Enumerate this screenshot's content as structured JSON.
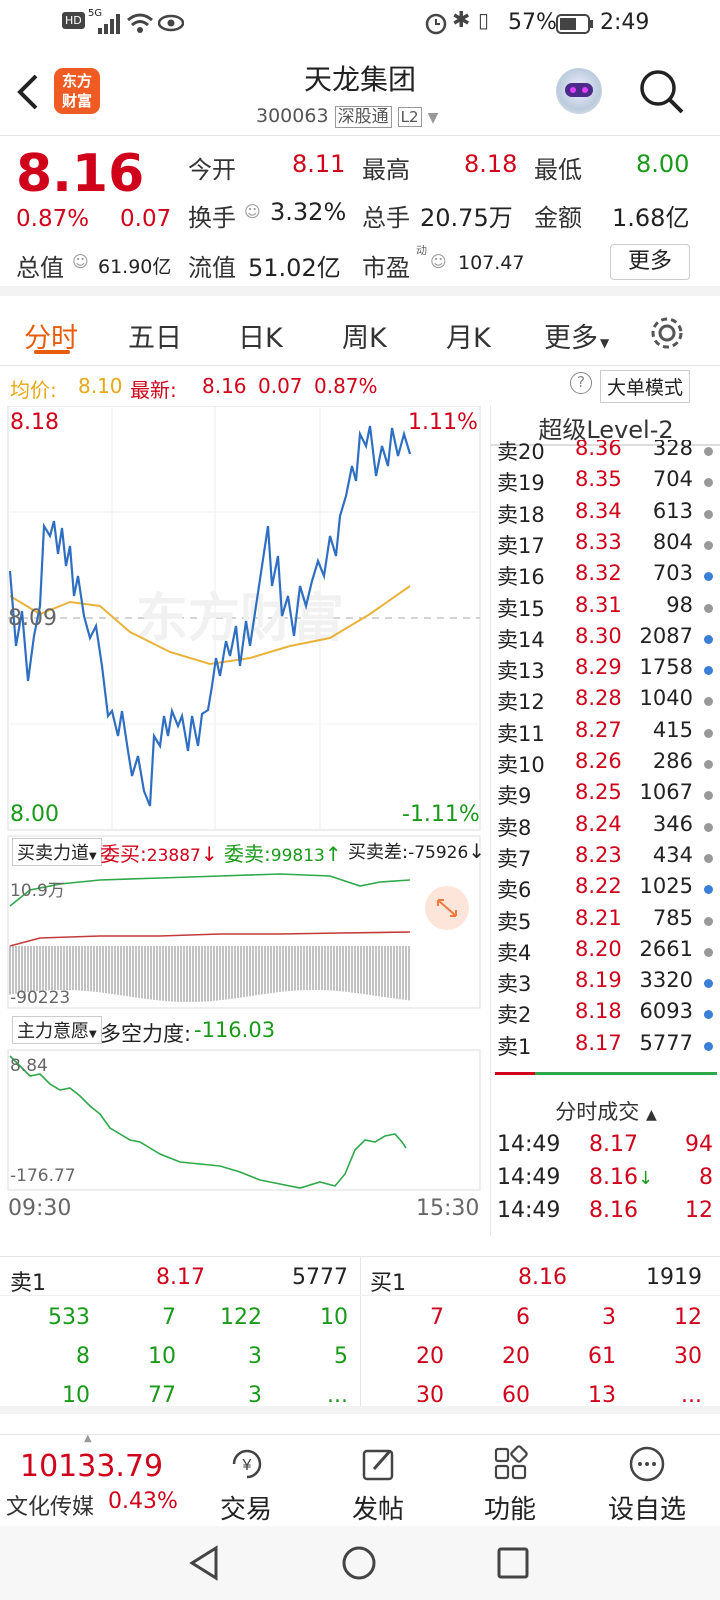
{
  "status": {
    "network": "5G",
    "battery": "57%",
    "time": "2:49"
  },
  "header": {
    "title": "天龙集团",
    "code": "300063",
    "tag1": "深股通",
    "tag2": "L2",
    "logo_line1": "东方",
    "logo_line2": "财富"
  },
  "quote": {
    "price": "8.16",
    "pct": "0.87%",
    "chg": "0.07",
    "open_label": "今开",
    "open": "8.11",
    "high_label": "最高",
    "high": "8.18",
    "low_label": "最低",
    "low": "8.00",
    "turnover_label": "换手",
    "turnover": "3.32%",
    "volume_label": "总手",
    "volume": "20.75万",
    "amount_label": "金额",
    "amount": "1.68亿",
    "mcap_label": "总值",
    "mcap": "61.90亿",
    "float_label": "流值",
    "float": "51.02亿",
    "pe_label": "市盈",
    "pe_sup": "动",
    "pe": "107.47",
    "more": "更多"
  },
  "tabs": [
    "分时",
    "五日",
    "日K",
    "周K",
    "月K",
    "更多"
  ],
  "avg": {
    "avg_label": "均价:",
    "avg": "8.10",
    "last_label": "最新:",
    "last": "8.16",
    "chg": "0.07",
    "pct": "0.87%",
    "mode": "大单模式"
  },
  "chart": {
    "ymax": "8.18",
    "ymid": "8.09",
    "ymin": "8.00",
    "pmax": "1.11%",
    "pmin": "-1.11%",
    "watermark": "东方财富",
    "t_start": "09:30",
    "t_end": "15:30"
  },
  "power": {
    "label": "买卖力道",
    "buy_label": "委买:",
    "buy": "23887",
    "sell_label": "委卖:",
    "sell": "99813",
    "diff_label": "买卖差:",
    "diff": "-75926",
    "top": "10.9万",
    "bottom": "-90223"
  },
  "intent": {
    "label": "主力意愿",
    "ls_label": "多空力度:",
    "ls": "-116.03",
    "top": "8.84",
    "bottom": "-176.77"
  },
  "level2": {
    "title": "超级Level-2",
    "rows": [
      {
        "l": "卖20",
        "p": "8.36",
        "v": "328",
        "dot": "#999"
      },
      {
        "l": "卖19",
        "p": "8.35",
        "v": "704",
        "dot": "#999"
      },
      {
        "l": "卖18",
        "p": "8.34",
        "v": "613",
        "dot": "#999"
      },
      {
        "l": "卖17",
        "p": "8.33",
        "v": "804",
        "dot": "#999"
      },
      {
        "l": "卖16",
        "p": "8.32",
        "v": "703",
        "dot": "#3b7fd6"
      },
      {
        "l": "卖15",
        "p": "8.31",
        "v": "98",
        "dot": "#999"
      },
      {
        "l": "卖14",
        "p": "8.30",
        "v": "2087",
        "dot": "#3b7fd6"
      },
      {
        "l": "卖13",
        "p": "8.29",
        "v": "1758",
        "dot": "#3b7fd6"
      },
      {
        "l": "卖12",
        "p": "8.28",
        "v": "1040",
        "dot": "#999"
      },
      {
        "l": "卖11",
        "p": "8.27",
        "v": "415",
        "dot": "#999"
      },
      {
        "l": "卖10",
        "p": "8.26",
        "v": "286",
        "dot": "#999"
      },
      {
        "l": "卖9",
        "p": "8.25",
        "v": "1067",
        "dot": "#999"
      },
      {
        "l": "卖8",
        "p": "8.24",
        "v": "346",
        "dot": "#999"
      },
      {
        "l": "卖7",
        "p": "8.23",
        "v": "434",
        "dot": "#999"
      },
      {
        "l": "卖6",
        "p": "8.22",
        "v": "1025",
        "dot": "#3b7fd6"
      },
      {
        "l": "卖5",
        "p": "8.21",
        "v": "785",
        "dot": "#999"
      },
      {
        "l": "卖4",
        "p": "8.20",
        "v": "2661",
        "dot": "#999"
      },
      {
        "l": "卖3",
        "p": "8.19",
        "v": "3320",
        "dot": "#3b7fd6"
      },
      {
        "l": "卖2",
        "p": "8.18",
        "v": "6093",
        "dot": "#3b7fd6"
      },
      {
        "l": "卖1",
        "p": "8.17",
        "v": "5777",
        "dot": "#3b7fd6"
      }
    ],
    "ticks_title": "分时成交",
    "ticks": [
      {
        "t": "14:49",
        "p": "8.17",
        "v": "94",
        "arrow": ""
      },
      {
        "t": "14:49",
        "p": "8.16",
        "v": "8",
        "arrow": "↓"
      },
      {
        "t": "14:49",
        "p": "8.16",
        "v": "12",
        "arrow": ""
      }
    ]
  },
  "queue": {
    "sell_label": "卖1",
    "sell_price": "8.17",
    "sell_total": "5777",
    "buy_label": "买1",
    "buy_price": "8.16",
    "buy_total": "1919",
    "sell": [
      "533",
      "7",
      "122",
      "10",
      "8",
      "10",
      "3",
      "5",
      "10",
      "77",
      "3",
      "..."
    ],
    "buy": [
      "7",
      "6",
      "3",
      "12",
      "20",
      "20",
      "61",
      "30",
      "30",
      "60",
      "13",
      "..."
    ]
  },
  "bottom": {
    "index_value": "10133.79",
    "index_name": "文化传媒",
    "index_pct": "0.43%",
    "trade": "交易",
    "post": "发帖",
    "func": "功能",
    "watch": "设自选"
  }
}
